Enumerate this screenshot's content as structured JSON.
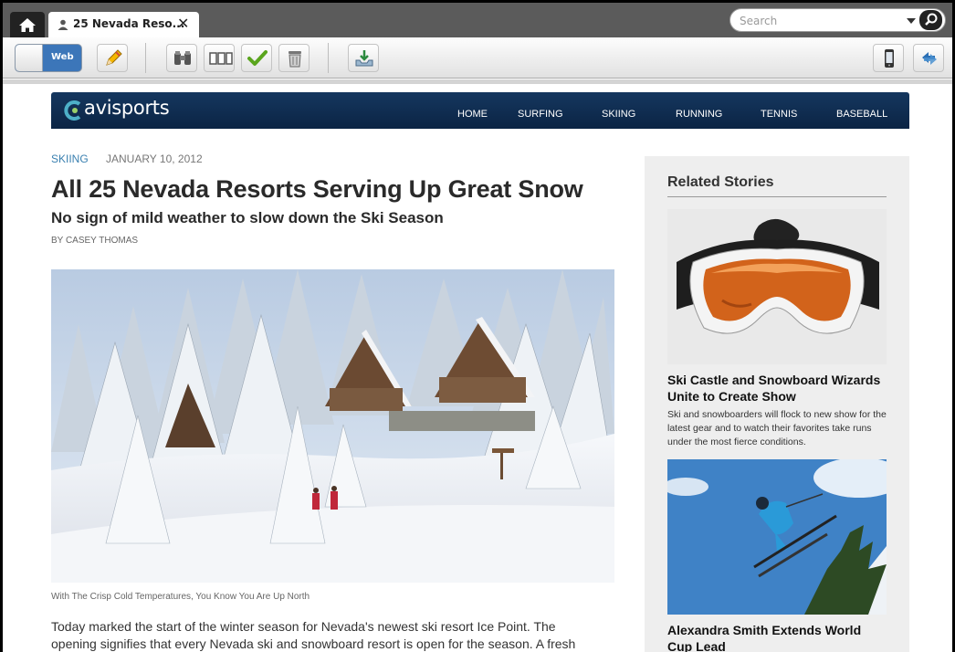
{
  "browser": {
    "tab_title": "25 Nevada Reso...",
    "search_placeholder": "Search",
    "mode_toggle_label": "Web"
  },
  "site": {
    "logo_text": "avisports",
    "nav": [
      "HOME",
      "SURFING",
      "SKIING",
      "RUNNING",
      "TENNIS",
      "BASEBALL"
    ]
  },
  "article": {
    "category": "SKIING",
    "date": "JANUARY 10, 2012",
    "headline": "All 25 Nevada Resorts Serving Up Great Snow",
    "subheadline": "No sign of mild weather to slow down the Ski Season",
    "byline": "BY CASEY THOMAS",
    "image_caption": "With The Crisp Cold Temperatures, You Know You Are Up North",
    "body": "Today marked the start of the winter season for Nevada's newest ski resort Ice Point. The opening signifies that every Nevada ski and snowboard resort is open for the season. A fresh"
  },
  "sidebar": {
    "heading": "Related Stories",
    "stories": [
      {
        "title": "Ski Castle and Snowboard Wizards Unite to Create Show",
        "description": "Ski and snowboarders will flock to new show for the latest gear and to watch their favorites take runs under the most fierce conditions."
      },
      {
        "title": "Alexandra Smith Extends World Cup Lead"
      }
    ]
  },
  "colors": {
    "header_navy": "#0b2444",
    "category_blue": "#3a80b0",
    "toggle_blue": "#3c76b9"
  }
}
